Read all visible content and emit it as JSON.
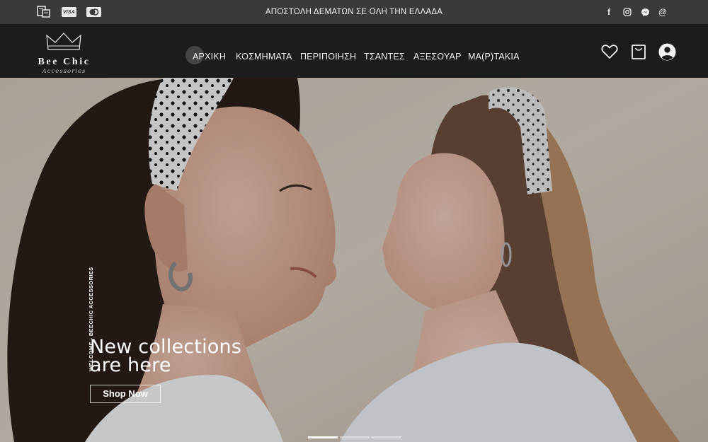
{
  "topbar": {
    "promo": "ΑΠΟΣΤΟΛΗ ΔΕΜΑΤΩΝ ΣΕ ΟΛΗ ΤΗΝ ΕΛΛΑΔΑ",
    "payments": {
      "visa_label": "VISA"
    },
    "social": {
      "facebook_glyph": "f",
      "email_glyph": "@"
    }
  },
  "header": {
    "logo_name": "Bee Chic",
    "logo_sub": "Accessories",
    "nav": [
      {
        "label": "ΑΡΧΙΚΗ"
      },
      {
        "label": "ΚΟΣΜΗΜΑΤΑ"
      },
      {
        "label": "ΠΕΡΙΠΟΙΗΣΗ"
      },
      {
        "label": "ΤΣΑΝΤΕΣ"
      },
      {
        "label": "ΑΞΕΣΟΥΑΡ"
      },
      {
        "label": "ΜΑ(Ρ)ΤΑΚΙΑ"
      }
    ]
  },
  "hero": {
    "vertical_text": "WELCOME - BEECHIC ACCESSORIES",
    "headline_line1": "New collections",
    "headline_line2": "are here",
    "cta_label": "Shop Now",
    "active_slide": 1,
    "slide_count": 3
  },
  "colors": {
    "topbar_bg": "#3a3a3a",
    "header_bg": "#1c1c1c",
    "text": "#ffffff"
  }
}
